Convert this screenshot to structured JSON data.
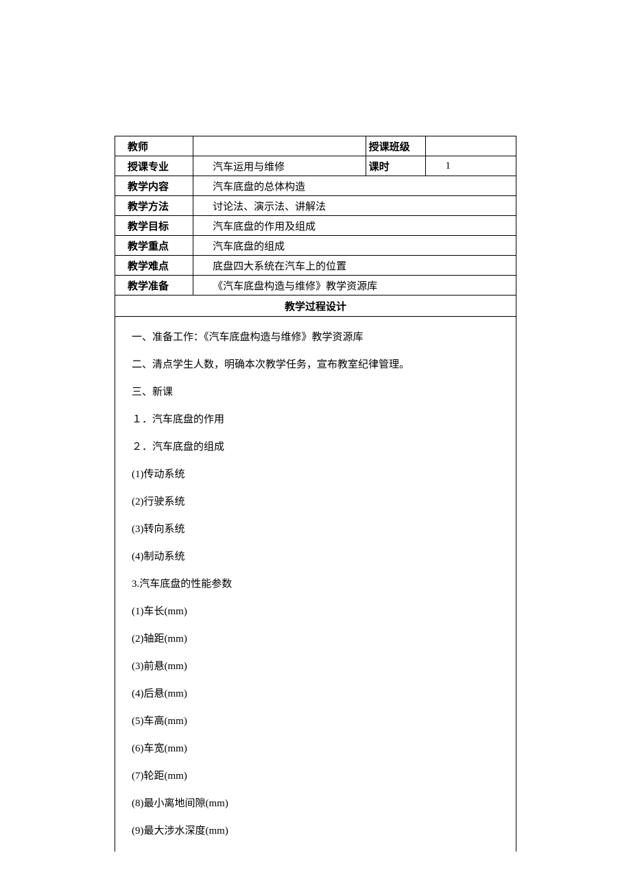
{
  "header": {
    "row1": {
      "label1": "教师",
      "val1": "",
      "label2": "授课班级",
      "val2": ""
    },
    "row2": {
      "label1": "授课专业",
      "val1": "汽车运用与维修",
      "label2": "课时",
      "val2": "1"
    },
    "row3": {
      "label": "教学内容",
      "val": "汽车底盘的总体构造"
    },
    "row4": {
      "label": "教学方法",
      "val": "讨论法、演示法、讲解法"
    },
    "row5": {
      "label": "教学目标",
      "val": "汽车底盘的作用及组成"
    },
    "row6": {
      "label": "教学重点",
      "val": "汽车底盘的组成"
    },
    "row7": {
      "label": "教学难点",
      "val": "底盘四大系统在汽车上的位置"
    },
    "row8": {
      "label": "教学准备",
      "val": "《汽车底盘构造与维修》教学资源库"
    }
  },
  "section_title": "教学过程设计",
  "content": {
    "l1": "一、准备工作：《汽车底盘构造与维修》教学资源库",
    "l2": "二、清点学生人数，明确本次教学任务，宣布教室纪律管理。",
    "l3": "三、新课",
    "l4": "１．汽车底盘的作用",
    "l5": "２．汽车底盘的组成",
    "l6": "(1)传动系统",
    "l7": "(2)行驶系统",
    "l8": "(3)转向系统",
    "l9": "(4)制动系统",
    "l10": "3.汽车底盘的性能参数",
    "l11": "(1)车长(mm)",
    "l12": "(2)轴距(mm)",
    "l13": "(3)前悬(mm)",
    "l14": "(4)后悬(mm)",
    "l15": "(5)车高(mm)",
    "l16": "(6)车宽(mm)",
    "l17": "(7)轮距(mm)",
    "l18": "(8)最小离地间隙(mm)",
    "l19": "(9)最大涉水深度(mm)"
  }
}
